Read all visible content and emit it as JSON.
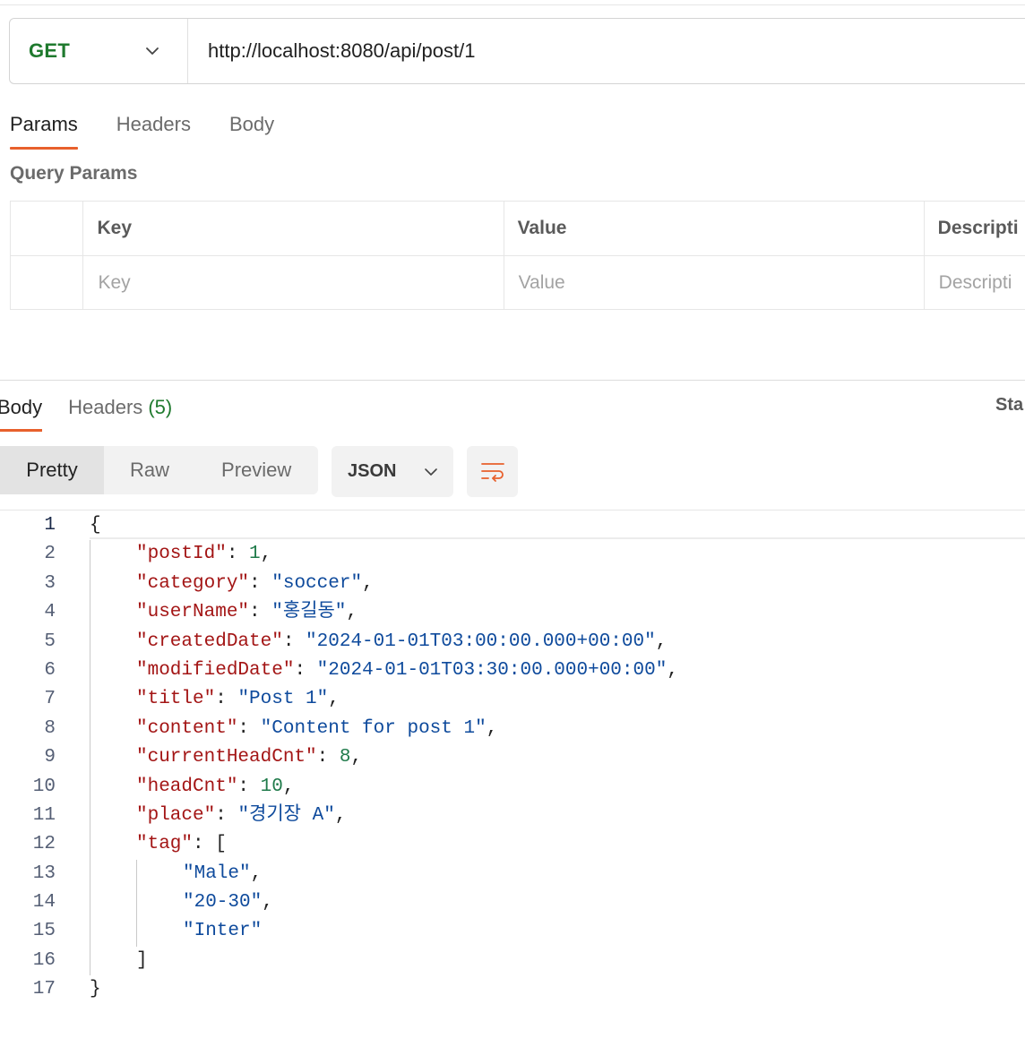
{
  "request": {
    "method": "GET",
    "url": "http://localhost:8080/api/post/1",
    "tabs": [
      "Params",
      "Headers",
      "Body"
    ],
    "active_tab": "Params"
  },
  "query_params": {
    "title": "Query Params",
    "columns": [
      "Key",
      "Value",
      "Descripti"
    ],
    "placeholders": [
      "Key",
      "Value",
      "Descripti"
    ]
  },
  "response": {
    "tabs": {
      "body": "Body",
      "headers": "Headers",
      "headers_count": "(5)"
    },
    "status_label": "Sta",
    "view_modes": [
      "Pretty",
      "Raw",
      "Preview"
    ],
    "active_view": "Pretty",
    "format": "JSON"
  },
  "code": {
    "lines": [
      [
        [
          "{",
          "pun"
        ]
      ],
      [
        [
          "\"postId\"",
          "key"
        ],
        [
          ": ",
          "pun"
        ],
        [
          "1",
          "num"
        ],
        [
          ",",
          "pun"
        ]
      ],
      [
        [
          "\"category\"",
          "key"
        ],
        [
          ": ",
          "pun"
        ],
        [
          "\"soccer\"",
          "str"
        ],
        [
          ",",
          "pun"
        ]
      ],
      [
        [
          "\"userName\"",
          "key"
        ],
        [
          ": ",
          "pun"
        ],
        [
          "\"홍길동\"",
          "str"
        ],
        [
          ",",
          "pun"
        ]
      ],
      [
        [
          "\"createdDate\"",
          "key"
        ],
        [
          ": ",
          "pun"
        ],
        [
          "\"2024-01-01T03:00:00.000+00:00\"",
          "str"
        ],
        [
          ",",
          "pun"
        ]
      ],
      [
        [
          "\"modifiedDate\"",
          "key"
        ],
        [
          ": ",
          "pun"
        ],
        [
          "\"2024-01-01T03:30:00.000+00:00\"",
          "str"
        ],
        [
          ",",
          "pun"
        ]
      ],
      [
        [
          "\"title\"",
          "key"
        ],
        [
          ": ",
          "pun"
        ],
        [
          "\"Post 1\"",
          "str"
        ],
        [
          ",",
          "pun"
        ]
      ],
      [
        [
          "\"content\"",
          "key"
        ],
        [
          ": ",
          "pun"
        ],
        [
          "\"Content for post 1\"",
          "str"
        ],
        [
          ",",
          "pun"
        ]
      ],
      [
        [
          "\"currentHeadCnt\"",
          "key"
        ],
        [
          ": ",
          "pun"
        ],
        [
          "8",
          "num"
        ],
        [
          ",",
          "pun"
        ]
      ],
      [
        [
          "\"headCnt\"",
          "key"
        ],
        [
          ": ",
          "pun"
        ],
        [
          "10",
          "num"
        ],
        [
          ",",
          "pun"
        ]
      ],
      [
        [
          "\"place\"",
          "key"
        ],
        [
          ": ",
          "pun"
        ],
        [
          "\"경기장 A\"",
          "str"
        ],
        [
          ",",
          "pun"
        ]
      ],
      [
        [
          "\"tag\"",
          "key"
        ],
        [
          ": [",
          "pun"
        ]
      ],
      [
        [
          "\"Male\"",
          "str"
        ],
        [
          ",",
          "pun"
        ]
      ],
      [
        [
          "\"20-30\"",
          "str"
        ],
        [
          ",",
          "pun"
        ]
      ],
      [
        [
          "\"Inter\"",
          "str"
        ]
      ],
      [
        [
          "]",
          "pun"
        ]
      ],
      [
        [
          "}",
          "pun"
        ]
      ]
    ],
    "indent": [
      0,
      1,
      1,
      1,
      1,
      1,
      1,
      1,
      1,
      1,
      1,
      1,
      2,
      2,
      2,
      1,
      0
    ]
  },
  "colors": {
    "accent": "#e8602c",
    "method_green": "#1f7a2e",
    "json_key": "#a31515",
    "json_string": "#0e4a9c",
    "json_number": "#1f7a4a"
  },
  "icons": {
    "method_dropdown": "chevron-down-icon",
    "format_dropdown": "chevron-down-icon",
    "wrap": "wrap-lines-icon"
  }
}
